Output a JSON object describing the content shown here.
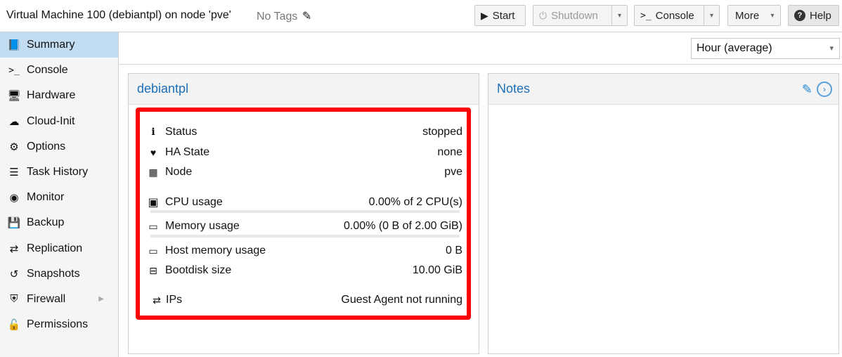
{
  "header": {
    "title": "Virtual Machine 100 (debiantpl) on node 'pve'",
    "tags_label": "No Tags",
    "buttons": {
      "start": "Start",
      "shutdown": "Shutdown",
      "console": "Console",
      "more": "More",
      "help": "Help"
    }
  },
  "sidebar": {
    "items": [
      {
        "label": "Summary",
        "icon": "book-icon"
      },
      {
        "label": "Console",
        "icon": "terminal-icon"
      },
      {
        "label": "Hardware",
        "icon": "monitor-icon"
      },
      {
        "label": "Cloud-Init",
        "icon": "cloud-icon"
      },
      {
        "label": "Options",
        "icon": "gear-icon"
      },
      {
        "label": "Task History",
        "icon": "list-icon"
      },
      {
        "label": "Monitor",
        "icon": "eye-icon"
      },
      {
        "label": "Backup",
        "icon": "floppy-icon"
      },
      {
        "label": "Replication",
        "icon": "retweet-icon"
      },
      {
        "label": "Snapshots",
        "icon": "history-icon"
      },
      {
        "label": "Firewall",
        "icon": "shield-icon"
      },
      {
        "label": "Permissions",
        "icon": "unlock-icon"
      }
    ]
  },
  "timeframe": {
    "selected": "Hour (average)"
  },
  "summary_panel": {
    "title": "debiantpl",
    "rows": {
      "status": {
        "label": "Status",
        "value": "stopped"
      },
      "ha_state": {
        "label": "HA State",
        "value": "none"
      },
      "node": {
        "label": "Node",
        "value": "pve"
      },
      "cpu": {
        "label": "CPU usage",
        "value": "0.00% of 2 CPU(s)"
      },
      "memory": {
        "label": "Memory usage",
        "value": "0.00% (0 B of 2.00 GiB)"
      },
      "host_memory": {
        "label": "Host memory usage",
        "value": "0 B"
      },
      "bootdisk": {
        "label": "Bootdisk size",
        "value": "10.00 GiB"
      },
      "ips": {
        "label": "IPs",
        "value": "Guest Agent not running"
      }
    }
  },
  "notes_panel": {
    "title": "Notes"
  },
  "colors": {
    "accent": "#1d6fb8",
    "highlight": "#ff0000",
    "nav_active": "#c2ddf2"
  }
}
